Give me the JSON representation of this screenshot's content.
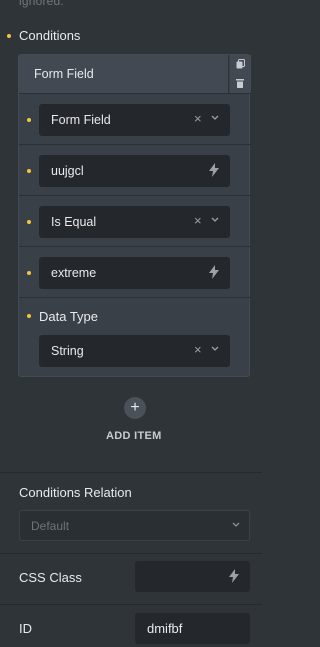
{
  "clipped_text": "ignored.",
  "conditions": {
    "label": "Conditions",
    "repeater": {
      "header_label": "Form Field",
      "rows": [
        {
          "type": "select",
          "value": "Form Field",
          "clear_glyph": "×"
        },
        {
          "type": "text",
          "value": "uujgcl"
        },
        {
          "type": "select",
          "value": "Is Equal",
          "clear_glyph": "×"
        },
        {
          "type": "text",
          "value": "extreme"
        },
        {
          "type": "select",
          "label": "Data Type",
          "value": "String",
          "clear_glyph": "×"
        }
      ]
    },
    "add_item": {
      "icon": "+",
      "label": "ADD ITEM"
    }
  },
  "conditions_relation": {
    "label": "Conditions Relation",
    "placeholder": "Default"
  },
  "css_class": {
    "label": "CSS Class",
    "value": ""
  },
  "id_field": {
    "label": "ID",
    "value": "dmifbf"
  },
  "colors": {
    "accent_dot": "#f5c43d",
    "background": "#2f3439",
    "field_bg": "#24282c"
  }
}
